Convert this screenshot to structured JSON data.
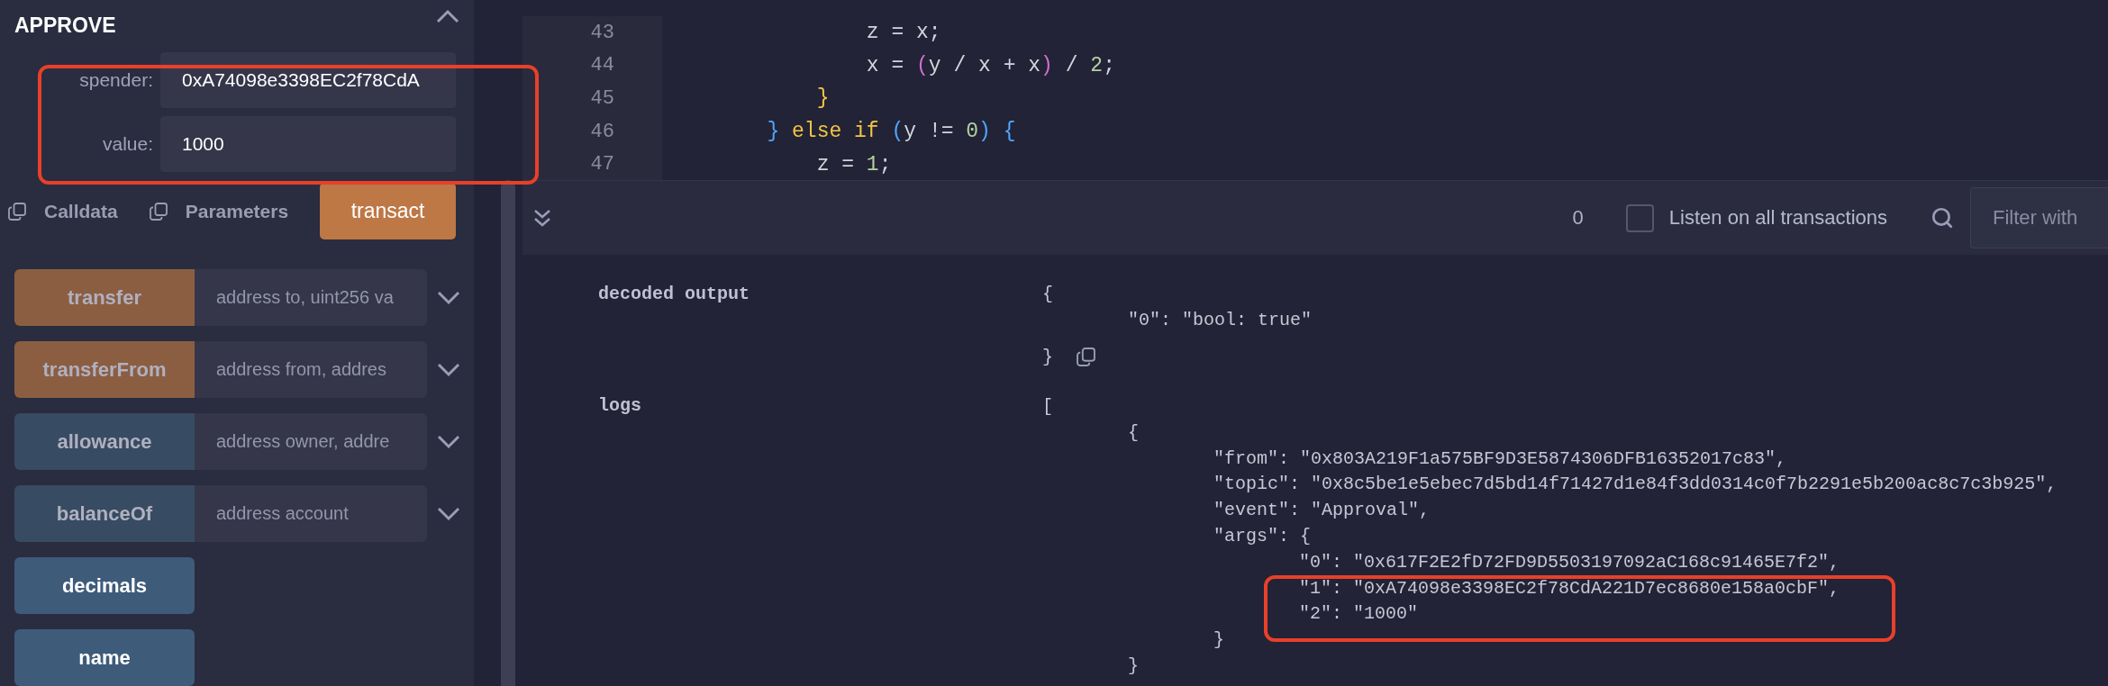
{
  "panel": {
    "title": "APPROVE",
    "expanded": true,
    "fields": [
      {
        "label": "spender:",
        "value": "0xA74098e3398EC2f78CdA"
      },
      {
        "label": "value:",
        "value": "1000"
      }
    ],
    "copy_links": [
      "Calldata",
      "Parameters"
    ],
    "submit": "transact",
    "functions": [
      {
        "name": "transfer",
        "kind": "transact",
        "placeholder": "address to, uint256 va",
        "expanded": false
      },
      {
        "name": "transferFrom",
        "kind": "transact",
        "placeholder": "address from, addres",
        "expanded": false
      },
      {
        "name": "allowance",
        "kind": "call",
        "placeholder": "address owner, addre",
        "expanded": false
      },
      {
        "name": "balanceOf",
        "kind": "call",
        "placeholder": "address account",
        "expanded": false
      },
      {
        "name": "decimals",
        "kind": "call"
      },
      {
        "name": "name",
        "kind": "call"
      }
    ]
  },
  "editor": {
    "lines": [
      {
        "number": "43",
        "tokens": [
          {
            "text": "                z = x;",
            "color": "#d4d4dc"
          }
        ]
      },
      {
        "number": "44",
        "tokens": [
          {
            "text": "                x = ",
            "color": "#d4d4dc"
          },
          {
            "text": "(",
            "color": "#d070d0"
          },
          {
            "text": "y / x + x",
            "color": "#d4d4dc"
          },
          {
            "text": ")",
            "color": "#d070d0"
          },
          {
            "text": " / ",
            "color": "#d4d4dc"
          },
          {
            "text": "2",
            "color": "#b5d0a0"
          },
          {
            "text": ";",
            "color": "#d4d4dc"
          }
        ]
      },
      {
        "number": "45",
        "tokens": [
          {
            "text": "            }",
            "color": "#f5c542"
          }
        ]
      },
      {
        "number": "46",
        "tokens": [
          {
            "text": "        }",
            "color": "#4fa6ff"
          },
          {
            "text": " else if ",
            "color": "#f5c542"
          },
          {
            "text": "(",
            "color": "#4fa6ff"
          },
          {
            "text": "y != ",
            "color": "#d4d4dc"
          },
          {
            "text": "0",
            "color": "#b5d0a0"
          },
          {
            "text": ")",
            "color": "#4fa6ff"
          },
          {
            "text": " {",
            "color": "#4fa6ff"
          }
        ]
      },
      {
        "number": "47",
        "tokens": [
          {
            "text": "            z = ",
            "color": "#d4d4dc"
          },
          {
            "text": "1",
            "color": "#b5d0a0"
          },
          {
            "text": ";",
            "color": "#d4d4dc"
          }
        ]
      }
    ]
  },
  "terminal": {
    "count": "0",
    "listen": {
      "label": "Listen on all transactions",
      "checked": false
    },
    "filter": {
      "placeholder": "Filter with"
    },
    "rows": [
      {
        "key": "decoded output",
        "value": [
          {
            "text": "{",
            "children": [
              {
                "text": "\"0\": \"bool: true\""
              }
            ]
          },
          {
            "text": "}",
            "copyable": true
          }
        ]
      },
      {
        "key": "logs",
        "value": [
          {
            "text": "[",
            "children": [
              {
                "text": "{",
                "children": [
                  {
                    "text": "\"from\": \"0x803A219F1a575BF9D3E5874306DFB16352017c83\","
                  },
                  {
                    "text": "\"topic\": \"0x8c5be1e5ebec7d5bd14f71427d1e84f3dd0314c0f7b2291e5b200ac8c7c3b925\","
                  },
                  {
                    "text": "\"event\": \"Approval\","
                  },
                  {
                    "text": "\"args\": {",
                    "children": [
                      {
                        "text": "\"0\": \"0x617F2E2fD72FD9D5503197092aC168c91465E7f2\","
                      },
                      {
                        "text": "\"1\": \"0xA74098e3398EC2f78CdA221D7ec8680e158a0cbF\","
                      },
                      {
                        "text": "\"2\": \"1000\""
                      }
                    ]
                  },
                  {
                    "text": "}"
                  }
                ]
              },
              {
                "text": "}"
              }
            ]
          }
        ]
      }
    ]
  }
}
